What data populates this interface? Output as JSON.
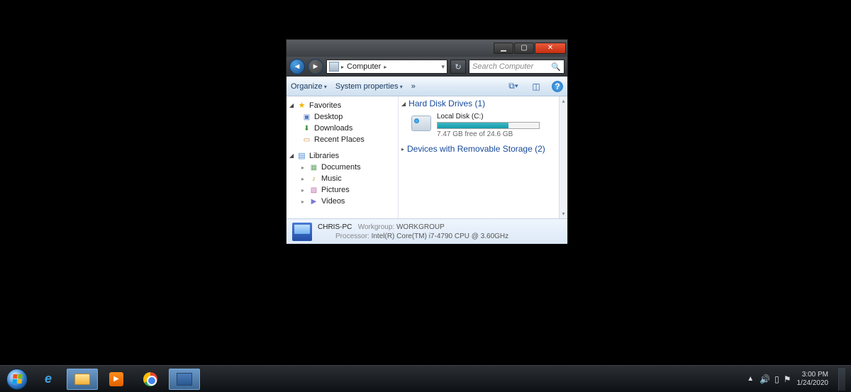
{
  "window": {
    "address": {
      "root_icon": "computer",
      "segments": [
        "Computer"
      ]
    },
    "search_placeholder": "Search Computer",
    "toolbar": {
      "organize": "Organize",
      "system_properties": "System properties",
      "more": "»"
    },
    "sidebar": {
      "favorites": {
        "label": "Favorites",
        "items": [
          {
            "label": "Desktop"
          },
          {
            "label": "Downloads"
          },
          {
            "label": "Recent Places"
          }
        ]
      },
      "libraries": {
        "label": "Libraries",
        "items": [
          {
            "label": "Documents"
          },
          {
            "label": "Music"
          },
          {
            "label": "Pictures"
          },
          {
            "label": "Videos"
          }
        ]
      }
    },
    "content": {
      "hdd": {
        "header": "Hard Disk Drives (1)",
        "drive": {
          "name": "Local Disk (C:)",
          "free_text": "7.47 GB free of 24.6 GB",
          "used_pct": 70
        }
      },
      "removable_header": "Devices with Removable Storage (2)"
    },
    "details": {
      "computer_name": "CHRIS-PC",
      "workgroup_label": "Workgroup:",
      "workgroup": "WORKGROUP",
      "processor_label": "Processor:",
      "processor": "Intel(R) Core(TM) i7-4790 CPU @ 3.60GHz"
    }
  },
  "taskbar": {
    "tray_chevron": "▲",
    "time": "3:00 PM",
    "date": "1/24/2020"
  }
}
